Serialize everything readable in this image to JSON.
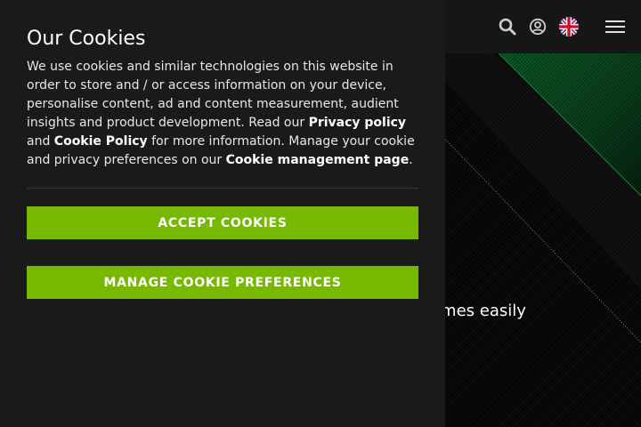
{
  "cookie_banner": {
    "title": "Our Cookies",
    "body_intro": "We use cookies and similar technologies on this website in order to store and / or access information on your device, personalise content, ad and content measurement, audient insights and product development. Read our ",
    "privacy_link": "Privacy policy",
    "and_text": " and ",
    "cookie_policy_link": "Cookie Policy",
    "body_middle": " for more information. Manage your cookie and privacy preferences on our ",
    "management_link": "Cookie management page",
    "body_end": ".",
    "accept_label": "ACCEPT COOKIES",
    "manage_label": "MANAGE COOKIE PREFERENCES"
  },
  "header": {
    "icons": [
      "search-icon",
      "account-icon",
      "language-flag-uk-icon",
      "hamburger-menu-icon"
    ]
  },
  "hero": {
    "visible_text": "ames easily"
  },
  "colors": {
    "accent": "#76b900",
    "panel_bg": "#1a1a1a",
    "header_bg": "#161616"
  }
}
